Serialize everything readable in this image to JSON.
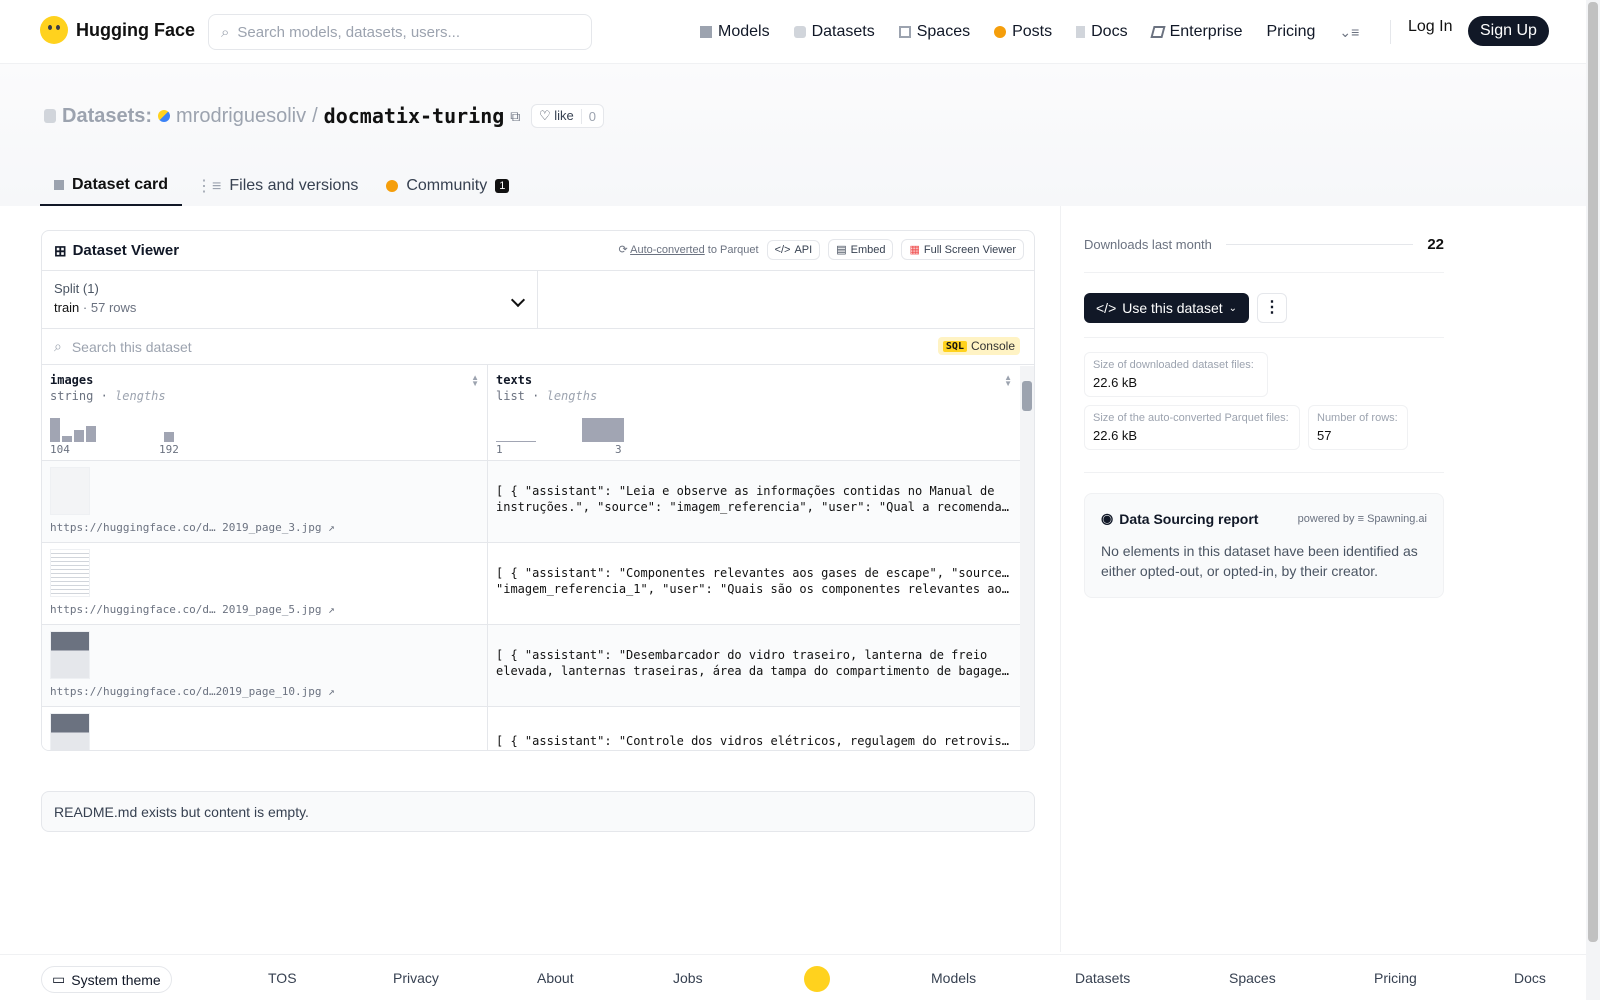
{
  "nav": {
    "brand": "Hugging Face",
    "search_placeholder": "Search models, datasets, users...",
    "items": [
      "Models",
      "Datasets",
      "Spaces",
      "Posts",
      "Docs",
      "Enterprise",
      "Pricing"
    ],
    "login": "Log In",
    "signup": "Sign Up"
  },
  "header": {
    "label": "Datasets:",
    "user": "mrodriguesoliv",
    "sep": "/",
    "name": "docmatix-turing",
    "like": "like",
    "likes": "0"
  },
  "tabs": [
    {
      "label": "Dataset card"
    },
    {
      "label": "Files and versions"
    },
    {
      "label": "Community",
      "badge": "1"
    }
  ],
  "viewer": {
    "title": "Dataset Viewer",
    "autoconv": "Auto-converted",
    "to_parquet": "to Parquet",
    "api": "API",
    "embed": "Embed",
    "fullscreen": "Full Screen Viewer",
    "split_label": "Split (1)",
    "split_name": "train",
    "split_sep": "·",
    "split_rows": "57 rows",
    "search_placeholder": "Search this dataset",
    "sql": "SQL",
    "console": "Console",
    "columns": [
      {
        "name": "images",
        "type": "string",
        "stat": "lengths",
        "min": "104",
        "max": "192"
      },
      {
        "name": "texts",
        "type": "list",
        "stat": "lengths",
        "min": "1",
        "max": "3"
      }
    ],
    "rows": [
      {
        "url": "https://huggingface.co/d… 2019_page_3.jpg ↗",
        "l1": "[ { \"assistant\": \"Leia e observe as informações contidas no Manual de",
        "l2": "instruções.\", \"source\": \"imagem_referencia\", \"user\": \"Qual a recomendaçã…"
      },
      {
        "url": "https://huggingface.co/d… 2019_page_5.jpg ↗",
        "l1": "[ { \"assistant\": \"Componentes relevantes aos gases de escape\", \"source\":",
        "l2": "\"imagem_referencia_1\", \"user\": \"Quais são os componentes relevantes aos…"
      },
      {
        "url": "https://huggingface.co/d…2019_page_10.jpg ↗",
        "l1": "[ { \"assistant\": \"Desembarcador do vidro traseiro, lanterna de freio",
        "l2": "elevada, lanternas traseiras, área da tampa do compartimento de bagagem,…"
      },
      {
        "url": "",
        "l1": "[ { \"assistant\": \"Controle dos vidros elétricos, regulagem do retrovisor",
        "l2": ""
      }
    ]
  },
  "readme": "README.md exists but content is empty.",
  "side": {
    "downloads_label": "Downloads last month",
    "downloads": "22",
    "use": "Use this dataset",
    "more": "⋮",
    "stats": [
      {
        "k": "Size of downloaded dataset files:",
        "v": "22.6 kB"
      },
      {
        "k": "Size of the auto-converted Parquet files:",
        "v": "22.6 kB"
      },
      {
        "k": "Number of rows:",
        "v": "57"
      }
    ],
    "report_title": "Data Sourcing report",
    "powered": "powered by",
    "spawning": "Spawning.ai",
    "report_text": "No elements in this dataset have been identified as either opted-out, or opted-in, by their creator."
  },
  "footer": {
    "theme": "System theme",
    "links": [
      "TOS",
      "Privacy",
      "About",
      "Jobs",
      "Models",
      "Datasets",
      "Spaces",
      "Pricing",
      "Docs"
    ]
  }
}
